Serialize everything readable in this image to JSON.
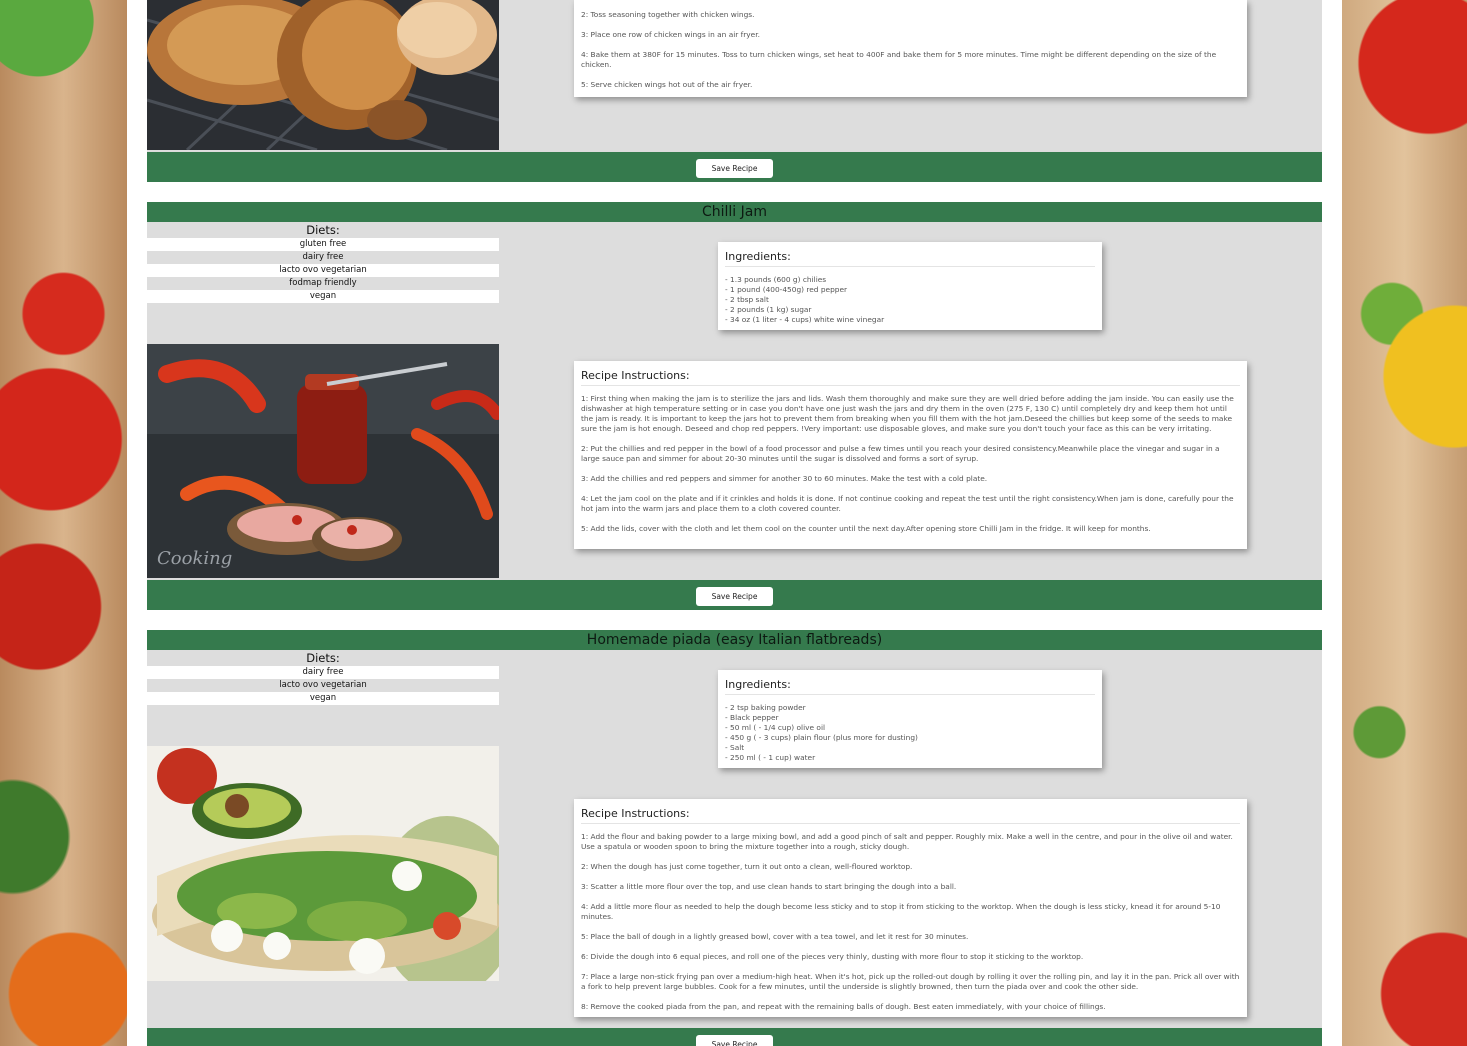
{
  "save_label": "Save Recipe",
  "recipe1": {
    "steps": [
      "2: Toss seasoning together with chicken wings.",
      "3: Place one row of chicken wings in an air fryer.",
      "4: Bake them at 380F for 15 minutes. Toss to turn chicken wings, set heat to 400F and bake them for 5 more minutes. Time might be different depending on the size of the chicken.",
      "5: Serve chicken wings hot out of the air fryer."
    ]
  },
  "recipe2": {
    "title": "Chilli Jam",
    "diets_label": "Diets:",
    "diets": [
      "gluten free",
      "dairy free",
      "lacto ovo vegetarian",
      "fodmap friendly",
      "vegan"
    ],
    "ingredients_label": "Ingredients:",
    "ingredients": [
      "- 1.3 pounds (600 g) chilies",
      "- 1 pound (400-450g) red pepper",
      "- 2 tbsp salt",
      "- 2 pounds (1 kg) sugar",
      "- 34 oz (1 liter - 4 cups) white wine vinegar"
    ],
    "instructions_label": "Recipe Instructions:",
    "steps": [
      "1: First thing when making the jam is to sterilize the jars and lids. Wash them thoroughly and make sure they are well dried before adding the jam inside. You can easily use the dishwasher at high temperature setting or in case you don't have one just wash the jars and dry them in the oven (275 F, 130 C) until completely dry and keep them hot until the jam is ready. It is important to keep the jars hot to prevent them from breaking when you fill them with the hot jam.Deseed the chillies but keep some of the seeds to make sure the jam is hot enough. Deseed and chop red peppers. !Very important: use disposable gloves, and make sure you don't touch your face as this can be very irritating.",
      "2: Put the chillies and red pepper in the bowl of a food processor and pulse a few times until you reach your desired consistency.Meanwhile place the vinegar and sugar in a large sauce pan and simmer for about 20-30 minutes until the sugar is dissolved and forms a sort of syrup.",
      "3: Add the chillies and red peppers and simmer for another 30 to 60 minutes. Make the test with a cold plate.",
      "4: Let the jam cool on the plate and if it crinkles and holds it is done. If not continue cooking and repeat the test until the right consistency.When jam is done,  carefully pour the hot jam into the warm jars and place them to a cloth covered counter.",
      "5: Add the lids, cover with the cloth and let them cool on the counter until the next day.After opening  store Chilli Jam in the fridge. It will keep for months."
    ]
  },
  "recipe3": {
    "title": "Homemade piada (easy Italian flatbreads)",
    "diets_label": "Diets:",
    "diets": [
      "dairy free",
      "lacto ovo vegetarian",
      "vegan"
    ],
    "ingredients_label": "Ingredients:",
    "ingredients": [
      "- 2 tsp baking powder",
      "- Black pepper",
      "- 50 ml ( - 1/4 cup) olive oil",
      "- 450 g ( - 3 cups) plain flour (plus more for dusting)",
      "- Salt",
      "- 250 ml ( - 1 cup) water"
    ],
    "instructions_label": "Recipe Instructions:",
    "steps": [
      "1: Add the flour and baking powder to a large mixing bowl, and add a good pinch of salt and pepper. Roughly mix. Make a well in the centre, and pour in the olive oil and water. Use a spatula or wooden spoon to bring the mixture together into a rough, sticky dough.",
      "2: When the dough has just come together, turn it out onto a clean, well-floured worktop.",
      "3: Scatter a little more flour over the top, and use clean hands to start bringing the dough into a ball.",
      "4: Add a little more flour as needed to help the dough become less sticky and to stop it from sticking to the worktop. When the dough is less sticky, knead it for around 5-10 minutes.",
      "5: Place the ball of dough in a lightly greased bowl, cover with a tea towel, and let it rest for 30 minutes.",
      "6: Divide the dough into 6 equal pieces, and roll one of the pieces very thinly, dusting with more flour to stop it sticking to the worktop.",
      "7: Place a large non-stick frying pan over a medium-high heat. When it's hot, pick up the rolled-out dough by rolling it over the rolling pin, and lay it in the pan. Prick all over with a fork to help prevent large bubbles. Cook for a few minutes, until the underside is slightly browned, then turn the piada over and cook the other side.",
      "8: Remove the cooked piada from the pan, and repeat with the remaining balls of dough. Best eaten immediately, with your choice of fillings."
    ]
  }
}
